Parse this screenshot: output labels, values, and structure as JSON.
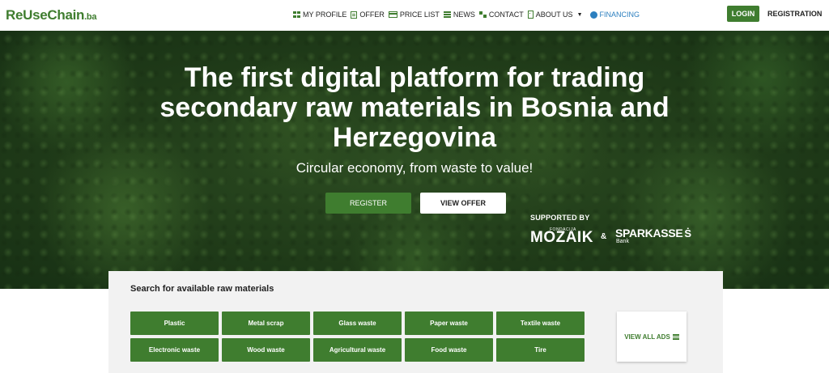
{
  "header": {
    "logo_main": "ReUseChain",
    "logo_tld": ".ba",
    "nav": [
      {
        "label": "MY PROFILE",
        "icon": "grid-icon"
      },
      {
        "label": "OFFER",
        "icon": "document-icon"
      },
      {
        "label": "PRICE LIST",
        "icon": "card-icon"
      },
      {
        "label": "NEWS",
        "icon": "list-icon"
      },
      {
        "label": "CONTACT",
        "icon": "sitemap-icon"
      },
      {
        "label": "ABOUT US",
        "icon": "building-icon"
      },
      {
        "label": "FINANCING",
        "icon": "money-bag-icon"
      }
    ],
    "login_label": "LOGIN",
    "registration_label": "REGISTRATION"
  },
  "hero": {
    "title": "The first digital platform for trading secondary raw materials in Bosnia and Herzegovina",
    "subtitle": "Circular economy, from waste to value!",
    "register_label": "REGISTER",
    "view_offer_label": "VIEW OFFER",
    "supported_by": "SUPPORTED BY",
    "sponsor1_small": "FONDACIJA",
    "sponsor1_name": "MOZAIK",
    "ampersand": "&",
    "sponsor2_name": "SPARKASSE",
    "sponsor2_mark": "Ṡ",
    "sponsor2_sub": "Bank"
  },
  "search": {
    "title": "Search for available raw materials",
    "categories": [
      "Plastic",
      "Metal scrap",
      "Glass waste",
      "Paper waste",
      "Textile waste",
      "Electronic waste",
      "Wood waste",
      "Agricultural waste",
      "Food waste",
      "Tire"
    ],
    "view_all_label": "VIEW ALL ADS"
  },
  "colors": {
    "brand_green": "#3f7d2f",
    "financing_blue": "#2c7fbf"
  }
}
